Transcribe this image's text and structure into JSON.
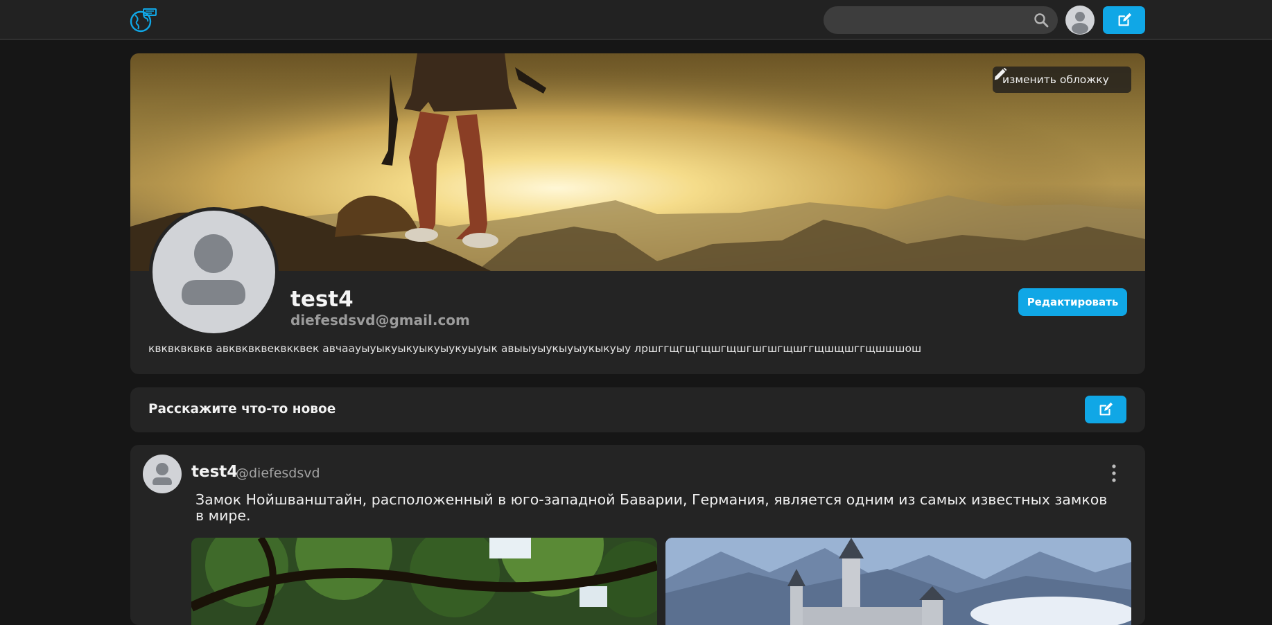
{
  "header": {
    "search": {
      "placeholder": "",
      "value": ""
    },
    "icons": [
      "globe-logo-icon",
      "search-icon",
      "user-avatar-icon",
      "edit-icon"
    ]
  },
  "profile": {
    "cover_button_label": "изменить обложку",
    "username": "test4",
    "email": "diefesdsvd@gmail.com",
    "edit_button_label": "Редактировать",
    "bio": "квквквквкв авквквквеквкквек авчаауыуыкуыкуыкуыукуыуык авыыуыукыуыукыкуыу лршггщгщгщшгщшгшгшгщшггщшщшггщшшшош"
  },
  "composer": {
    "prompt": "Расскажите что-то новое"
  },
  "post": {
    "author": "test4",
    "handle": "@diefesdsvd",
    "text": "Замок Нойшванштайн, расположенный в юго-западной Баварии, Германия, является одним из самых известных замков в мире.",
    "images": [
      "forest-photo",
      "castle-photo"
    ]
  },
  "colors": {
    "accent": "#10a7e6",
    "background": "#161616",
    "card": "#242424",
    "header": "#222222"
  }
}
